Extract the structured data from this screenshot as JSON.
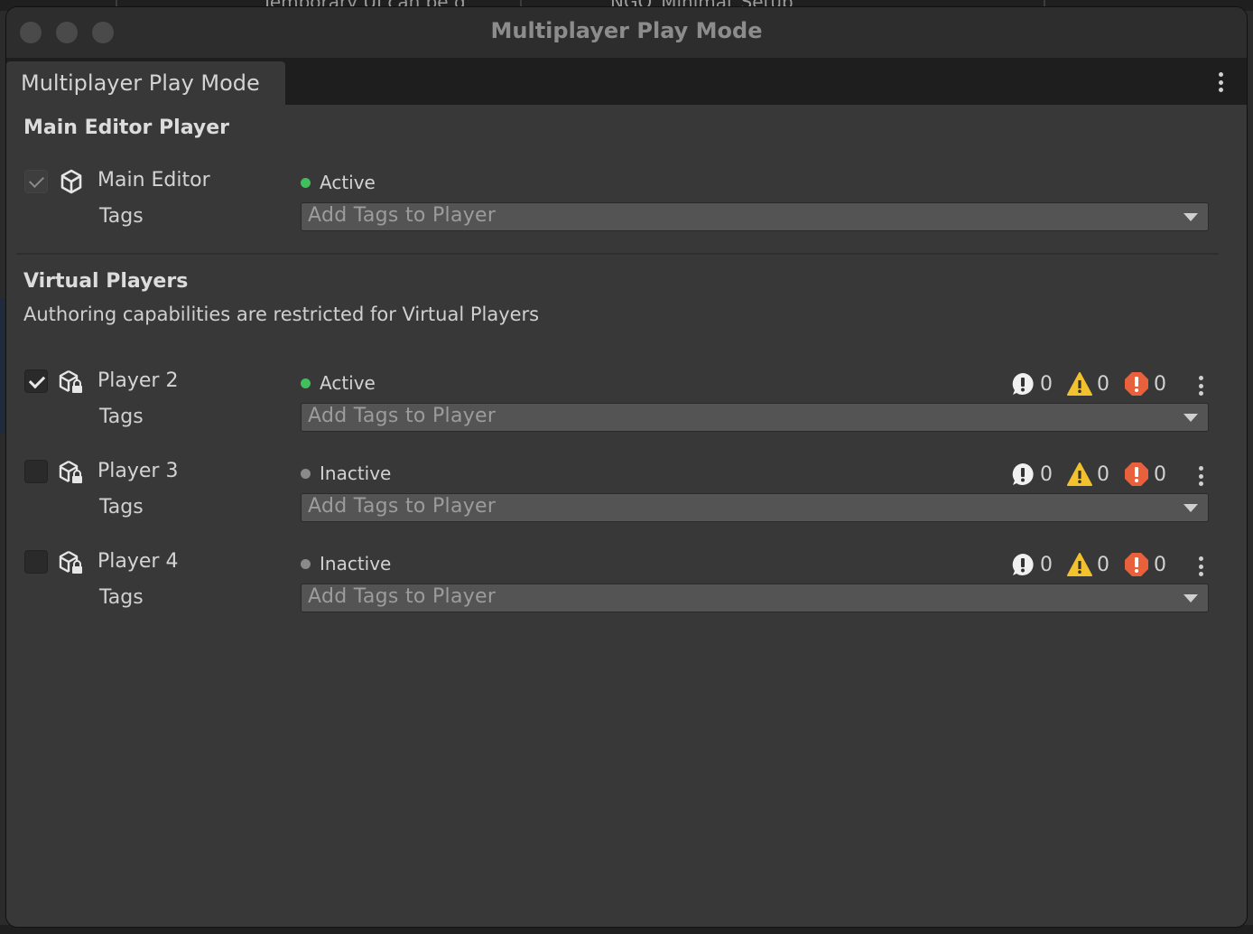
{
  "window": {
    "title": "Multiplayer Play Mode",
    "tab_label": "Multiplayer Play Mode"
  },
  "background": {
    "text_left": "Temporary UI  can be d",
    "text_right": "NGO_Minimal_Setup"
  },
  "main_section": {
    "title": "Main Editor Player",
    "player": {
      "name": "Main Editor",
      "checked": true,
      "status": "Active",
      "tags_label": "Tags",
      "tags_placeholder": "Add Tags to Player"
    }
  },
  "virtual_section": {
    "title": "Virtual Players",
    "subtitle": "Authoring capabilities are restricted for Virtual Players",
    "players": [
      {
        "name": "Player 2",
        "checked": true,
        "status": "Active",
        "tags_label": "Tags",
        "tags_placeholder": "Add Tags to Player",
        "info_count": "0",
        "warning_count": "0",
        "error_count": "0"
      },
      {
        "name": "Player 3",
        "checked": false,
        "status": "Inactive",
        "tags_label": "Tags",
        "tags_placeholder": "Add Tags to Player",
        "info_count": "0",
        "warning_count": "0",
        "error_count": "0"
      },
      {
        "name": "Player 4",
        "checked": false,
        "status": "Inactive",
        "tags_label": "Tags",
        "tags_placeholder": "Add Tags to Player",
        "info_count": "0",
        "warning_count": "0",
        "error_count": "0"
      }
    ]
  },
  "colors": {
    "active": "#3fc05b",
    "inactive": "#8a8a8a",
    "warning": "#f2c12e",
    "error": "#e8603c",
    "info": "#f0f0f0"
  }
}
